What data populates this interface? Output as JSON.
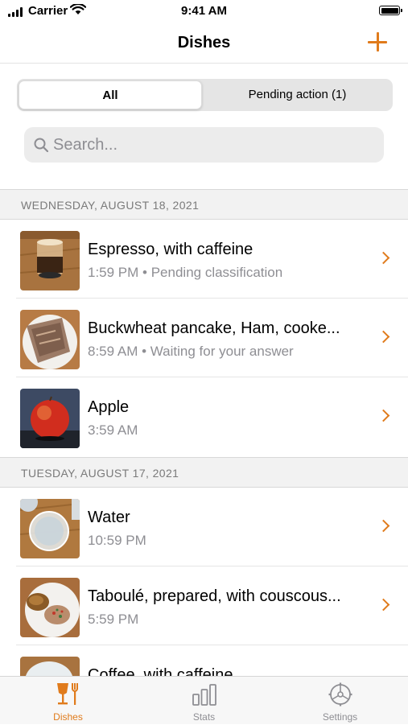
{
  "status_bar": {
    "carrier": "Carrier",
    "time": "9:41 AM"
  },
  "nav": {
    "title": "Dishes"
  },
  "segmented": {
    "all": "All",
    "pending": "Pending action (1)"
  },
  "search": {
    "placeholder": "Search..."
  },
  "sections": [
    {
      "header": "WEDNESDAY, AUGUST 18, 2021",
      "rows": [
        {
          "title": "Espresso, with caffeine",
          "subtitle": "1:59 PM • Pending classification",
          "thumb": "espresso"
        },
        {
          "title": "Buckwheat pancake, Ham, cooke...",
          "subtitle": "8:59 AM • Waiting for your answer",
          "thumb": "pancake"
        },
        {
          "title": "Apple",
          "subtitle": "3:59 AM",
          "thumb": "apple"
        }
      ]
    },
    {
      "header": "TUESDAY, AUGUST 17, 2021",
      "rows": [
        {
          "title": "Water",
          "subtitle": "10:59 PM",
          "thumb": "water"
        },
        {
          "title": "Taboulé, prepared, with couscous...",
          "subtitle": "5:59 PM",
          "thumb": "taboule"
        },
        {
          "title": "Coffee, with caffeine",
          "subtitle": "",
          "thumb": "coffee"
        }
      ]
    }
  ],
  "tabs": [
    {
      "label": "Dishes",
      "icon": "dishes-icon",
      "active": true
    },
    {
      "label": "Stats",
      "icon": "stats-icon",
      "active": false
    },
    {
      "label": "Settings",
      "icon": "settings-icon",
      "active": false
    }
  ],
  "colors": {
    "accent": "#e07b1c",
    "secondary_text": "#8e8e93",
    "section_bg": "#f2f2f2"
  }
}
